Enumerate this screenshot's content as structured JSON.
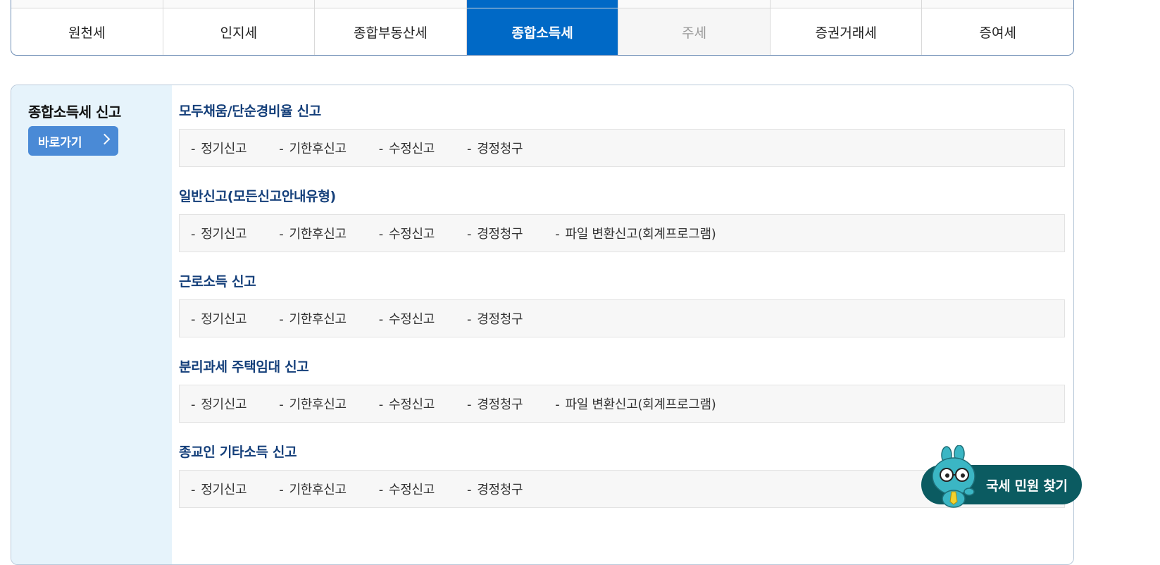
{
  "tabs": {
    "items": [
      {
        "label": "원천세"
      },
      {
        "label": "인지세"
      },
      {
        "label": "종합부동산세"
      },
      {
        "label": "종합소득세"
      },
      {
        "label": "주세"
      },
      {
        "label": "증권거래세"
      },
      {
        "label": "증여세"
      }
    ],
    "active_index": 3
  },
  "panel": {
    "title": "종합소득세 신고",
    "go_button": "바로가기",
    "sections": [
      {
        "title": "모두채움/단순경비율 신고",
        "links": [
          "정기신고",
          "기한후신고",
          "수정신고",
          "경정청구"
        ]
      },
      {
        "title": "일반신고(모든신고안내유형)",
        "links": [
          "정기신고",
          "기한후신고",
          "수정신고",
          "경정청구",
          "파일 변환신고(회계프로그램)"
        ]
      },
      {
        "title": "근로소득 신고",
        "links": [
          "정기신고",
          "기한후신고",
          "수정신고",
          "경정청구"
        ]
      },
      {
        "title": "분리과세 주택임대 신고",
        "links": [
          "정기신고",
          "기한후신고",
          "수정신고",
          "경정청구",
          "파일 변환신고(회계프로그램)"
        ]
      },
      {
        "title": "종교인 기타소득 신고",
        "links": [
          "정기신고",
          "기한후신고",
          "수정신고",
          "경정청구"
        ]
      }
    ]
  },
  "floating": {
    "label": "국세 민원 찾기"
  },
  "colors": {
    "active_tab": "#0069c6",
    "section_title": "#143f7a",
    "side_bg": "#e6f3fb",
    "go_button": "#4a8ad6",
    "fab_bg": "#0b5b61",
    "mascot": "#3bb6c4"
  }
}
